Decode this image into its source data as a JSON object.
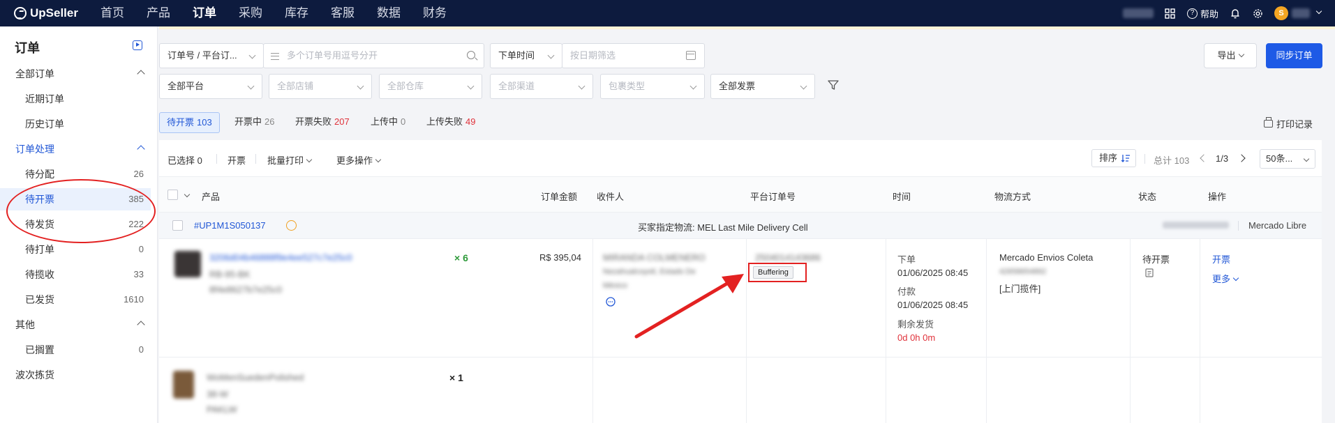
{
  "brand": "UpSeller",
  "nav": [
    "首页",
    "产品",
    "订单",
    "采购",
    "库存",
    "客服",
    "数据",
    "财务"
  ],
  "topright": {
    "help": "帮助",
    "avatar_letter": "S"
  },
  "sidebar": {
    "title": "订单",
    "groups": [
      {
        "label": "全部订单"
      },
      {
        "label": "近期订单"
      },
      {
        "label": "历史订单"
      },
      {
        "label": "订单处理"
      },
      {
        "label": "待分配",
        "count": "26"
      },
      {
        "label": "待开票",
        "count": "385"
      },
      {
        "label": "待发货",
        "count": "222"
      },
      {
        "label": "待打单",
        "count": "0"
      },
      {
        "label": "待揽收",
        "count": "33"
      },
      {
        "label": "已发货",
        "count": "1610"
      },
      {
        "label": "其他"
      },
      {
        "label": "已搁置",
        "count": "0"
      },
      {
        "label": "波次拣货"
      }
    ]
  },
  "filters": {
    "order_type": "订单号 / 平台订...",
    "order_search_placeholder": "多个订单号用逗号分开",
    "time_type": "下单时间",
    "date_placeholder": "按日期筛选",
    "platform": "全部平台",
    "shop": "全部店铺",
    "warehouse": "全部仓库",
    "channel": "全部渠道",
    "package_type": "包裹类型",
    "invoice": "全部发票",
    "export": "导出",
    "sync": "同步订单"
  },
  "status_tabs": [
    {
      "label": "待开票",
      "count": "103"
    },
    {
      "label": "开票中",
      "count": "26"
    },
    {
      "label": "开票失败",
      "count": "207"
    },
    {
      "label": "上传中",
      "count": "0"
    },
    {
      "label": "上传失败",
      "count": "49"
    }
  ],
  "print_log": "打印记录",
  "toolbar": {
    "selected": "已选择 0",
    "invoice": "开票",
    "batch_print": "批量打印",
    "more_actions": "更多操作",
    "sort": "排序",
    "total": "总计 103",
    "page": "1/3",
    "per_page": "50条..."
  },
  "columns": [
    "产品",
    "订单金额",
    "收件人",
    "平台订单号",
    "时间",
    "物流方式",
    "状态",
    "操作"
  ],
  "order": {
    "number": "#UP1M1S050137",
    "buyer_logistics": "买家指定物流: MEL Last Mile Delivery Cell",
    "platform": "Mercado Libre",
    "qty1": "× 6",
    "qty2": "× 1",
    "amount": "R$ 395,04",
    "platform_order_tag": "Buffering",
    "time_order_label": "下单",
    "time_order": "01/06/2025 08:45",
    "time_paid_label": "付款",
    "time_paid": "01/06/2025 08:45",
    "remaining_label": "剩余发货",
    "remaining": "0d 0h 0m",
    "logistics": "Mercado Envios Coleta",
    "logistics_pickup": "[上门揽件]",
    "status": "待开票",
    "action_invoice": "开票",
    "action_more": "更多"
  },
  "colors": {
    "nav_bg": "#0d1b3e",
    "accent": "#1e5ae6",
    "annotation_red": "#e32121"
  }
}
